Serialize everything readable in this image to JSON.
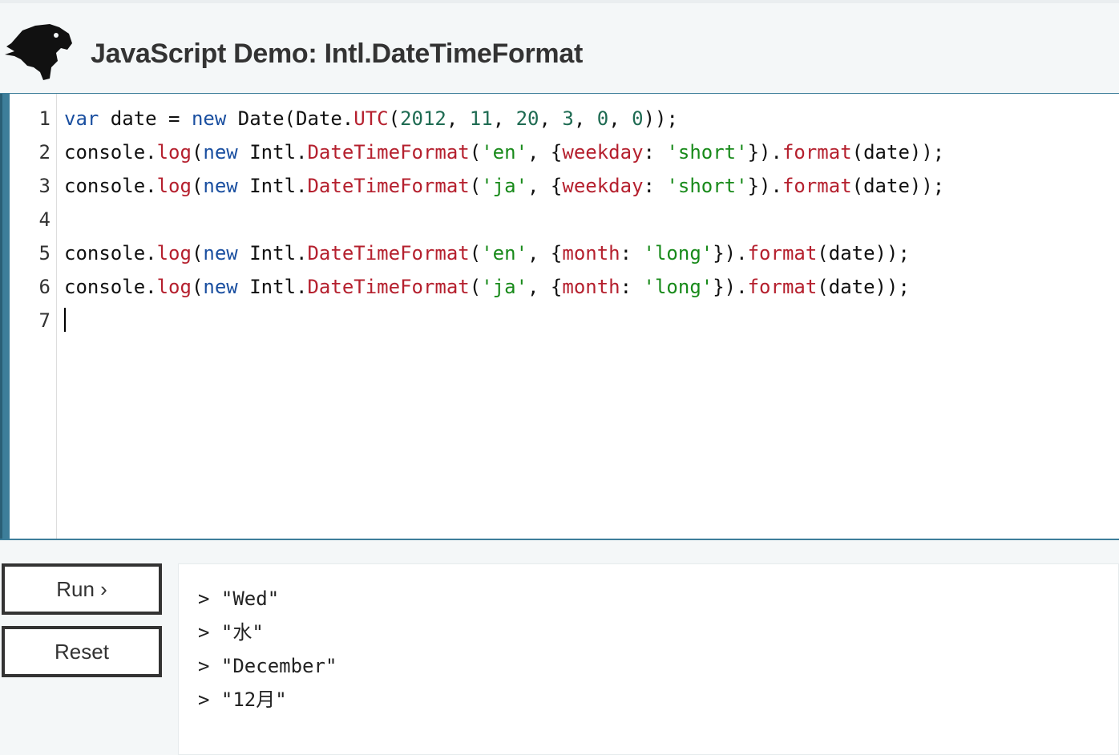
{
  "header": {
    "title": "JavaScript Demo: Intl.DateTimeFormat",
    "logo_icon": "dinosaur-head-icon"
  },
  "editor": {
    "line_numbers": [
      "1",
      "2",
      "3",
      "4",
      "5",
      "6",
      "7"
    ],
    "lines": [
      [
        {
          "t": "var",
          "c": "kw"
        },
        {
          "t": " date = ",
          "c": ""
        },
        {
          "t": "new",
          "c": "kw"
        },
        {
          "t": " Date(Date.",
          "c": ""
        },
        {
          "t": "UTC",
          "c": "fn"
        },
        {
          "t": "(",
          "c": ""
        },
        {
          "t": "2012",
          "c": "num"
        },
        {
          "t": ", ",
          "c": ""
        },
        {
          "t": "11",
          "c": "num"
        },
        {
          "t": ", ",
          "c": ""
        },
        {
          "t": "20",
          "c": "num"
        },
        {
          "t": ", ",
          "c": ""
        },
        {
          "t": "3",
          "c": "num"
        },
        {
          "t": ", ",
          "c": ""
        },
        {
          "t": "0",
          "c": "num"
        },
        {
          "t": ", ",
          "c": ""
        },
        {
          "t": "0",
          "c": "num"
        },
        {
          "t": "));",
          "c": ""
        }
      ],
      [
        {
          "t": "console.",
          "c": ""
        },
        {
          "t": "log",
          "c": "fn"
        },
        {
          "t": "(",
          "c": ""
        },
        {
          "t": "new",
          "c": "kw"
        },
        {
          "t": " Intl.",
          "c": ""
        },
        {
          "t": "DateTimeFormat",
          "c": "fn"
        },
        {
          "t": "(",
          "c": ""
        },
        {
          "t": "'en'",
          "c": "str"
        },
        {
          "t": ", {",
          "c": ""
        },
        {
          "t": "weekday",
          "c": "prop"
        },
        {
          "t": ": ",
          "c": ""
        },
        {
          "t": "'short'",
          "c": "str"
        },
        {
          "t": "}).",
          "c": ""
        },
        {
          "t": "format",
          "c": "fn"
        },
        {
          "t": "(date));",
          "c": ""
        }
      ],
      [
        {
          "t": "console.",
          "c": ""
        },
        {
          "t": "log",
          "c": "fn"
        },
        {
          "t": "(",
          "c": ""
        },
        {
          "t": "new",
          "c": "kw"
        },
        {
          "t": " Intl.",
          "c": ""
        },
        {
          "t": "DateTimeFormat",
          "c": "fn"
        },
        {
          "t": "(",
          "c": ""
        },
        {
          "t": "'ja'",
          "c": "str"
        },
        {
          "t": ", {",
          "c": ""
        },
        {
          "t": "weekday",
          "c": "prop"
        },
        {
          "t": ": ",
          "c": ""
        },
        {
          "t": "'short'",
          "c": "str"
        },
        {
          "t": "}).",
          "c": ""
        },
        {
          "t": "format",
          "c": "fn"
        },
        {
          "t": "(date));",
          "c": ""
        }
      ],
      [],
      [
        {
          "t": "console.",
          "c": ""
        },
        {
          "t": "log",
          "c": "fn"
        },
        {
          "t": "(",
          "c": ""
        },
        {
          "t": "new",
          "c": "kw"
        },
        {
          "t": " Intl.",
          "c": ""
        },
        {
          "t": "DateTimeFormat",
          "c": "fn"
        },
        {
          "t": "(",
          "c": ""
        },
        {
          "t": "'en'",
          "c": "str"
        },
        {
          "t": ", {",
          "c": ""
        },
        {
          "t": "month",
          "c": "prop"
        },
        {
          "t": ": ",
          "c": ""
        },
        {
          "t": "'long'",
          "c": "str"
        },
        {
          "t": "}).",
          "c": ""
        },
        {
          "t": "format",
          "c": "fn"
        },
        {
          "t": "(date));",
          "c": ""
        }
      ],
      [
        {
          "t": "console.",
          "c": ""
        },
        {
          "t": "log",
          "c": "fn"
        },
        {
          "t": "(",
          "c": ""
        },
        {
          "t": "new",
          "c": "kw"
        },
        {
          "t": " Intl.",
          "c": ""
        },
        {
          "t": "DateTimeFormat",
          "c": "fn"
        },
        {
          "t": "(",
          "c": ""
        },
        {
          "t": "'ja'",
          "c": "str"
        },
        {
          "t": ", {",
          "c": ""
        },
        {
          "t": "month",
          "c": "prop"
        },
        {
          "t": ": ",
          "c": ""
        },
        {
          "t": "'long'",
          "c": "str"
        },
        {
          "t": "}).",
          "c": ""
        },
        {
          "t": "format",
          "c": "fn"
        },
        {
          "t": "(date));",
          "c": ""
        }
      ],
      []
    ]
  },
  "buttons": {
    "run_label": "Run ›",
    "reset_label": "Reset"
  },
  "console": {
    "lines": [
      "> \"Wed\"",
      "> \"水\"",
      "> \"December\"",
      "> \"12月\""
    ]
  },
  "colors": {
    "accent": "#3d7e9a",
    "keyword": "#1a4fa0",
    "function": "#b5202e",
    "number": "#1e6b52",
    "string": "#188a1a"
  }
}
